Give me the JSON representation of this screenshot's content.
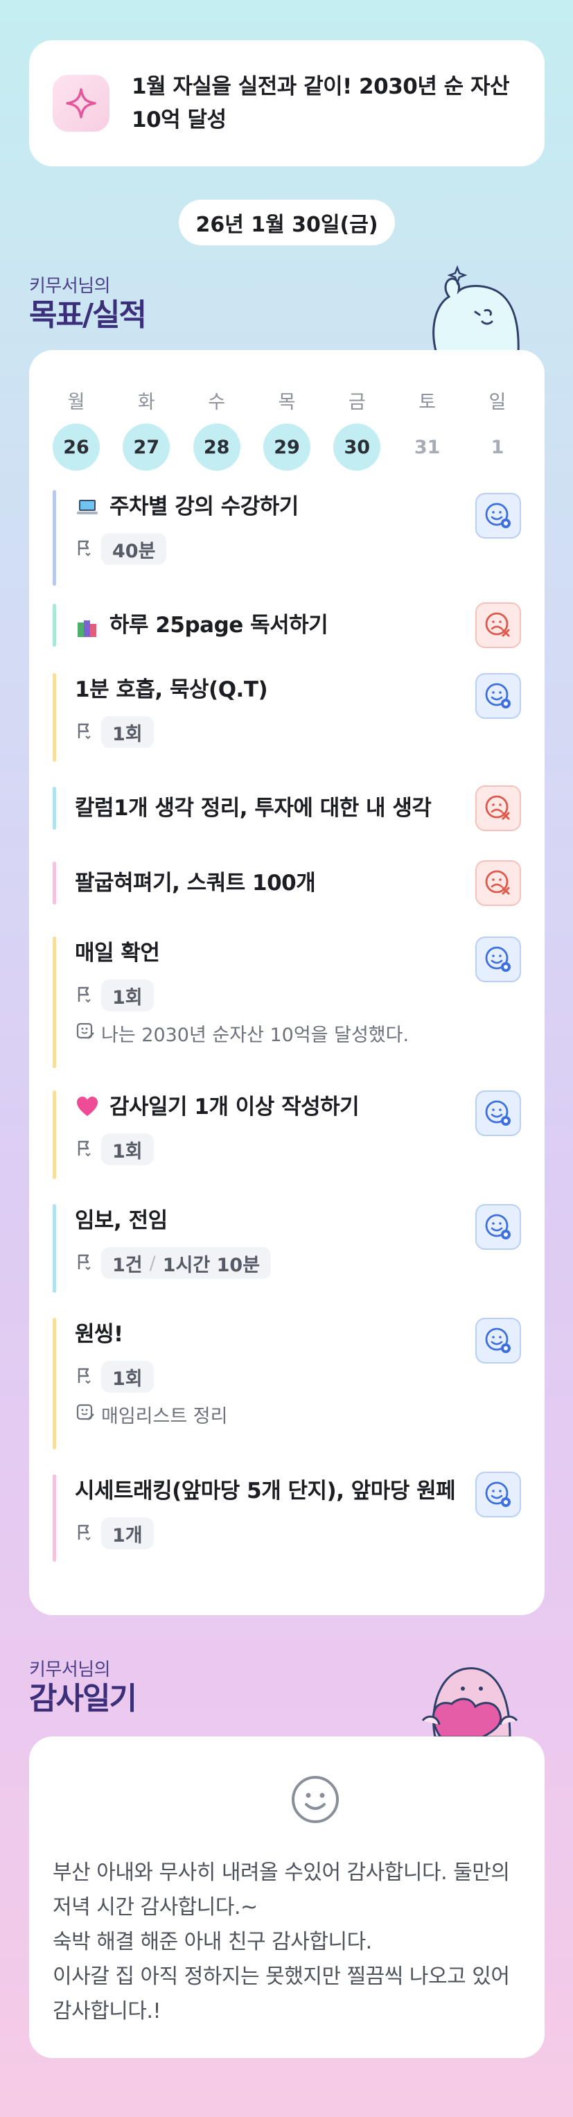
{
  "goal_banner": {
    "icon": "sparkle-icon",
    "text": "1월 자실을 실전과 같이! 2030년 순 자산 10억 달성"
  },
  "date_label": "26년 1월 30일(금)",
  "goals_section": {
    "subtitle": "키무서님의",
    "title": "목표/실적"
  },
  "week": [
    {
      "name": "월",
      "date": "26",
      "state": "done"
    },
    {
      "name": "화",
      "date": "27",
      "state": "done"
    },
    {
      "name": "수",
      "date": "28",
      "state": "done"
    },
    {
      "name": "목",
      "date": "29",
      "state": "done"
    },
    {
      "name": "금",
      "date": "30",
      "state": "done"
    },
    {
      "name": "토",
      "date": "31",
      "state": "none"
    },
    {
      "name": "일",
      "date": "1",
      "state": "none"
    }
  ],
  "items": [
    {
      "title": "주차별 강의 수강하기",
      "emoji": "laptop-icon",
      "chip": "40분",
      "status": "achieved",
      "bar_color": "#b9c8ef"
    },
    {
      "title": "하루 25page 독서하기",
      "emoji": "books-icon",
      "status": "failed",
      "bar_color": "#a8e6d8"
    },
    {
      "title": "1분 호흡, 묵상(Q.T)",
      "chip": "1회",
      "status": "achieved",
      "bar_color": "#f6de9f"
    },
    {
      "title": "칼럼1개 생각 정리, 투자에 대한 내 생각",
      "status": "failed",
      "bar_color": "#aee3ef"
    },
    {
      "title": "팔굽혀펴기, 스쿼트 100개",
      "status": "failed",
      "bar_color": "#f6c1dc"
    },
    {
      "title": "매일 확언",
      "chip": "1회",
      "note": "나는 2030년 순자산 10억을 달성했다.",
      "status": "achieved",
      "bar_color": "#f6de9f"
    },
    {
      "title": "감사일기 1개 이상 작성하기",
      "emoji": "heart-icon",
      "chip": "1회",
      "status": "achieved",
      "bar_color": "#f6de9f"
    },
    {
      "title": "임보, 전임",
      "chip": "1건",
      "chip2": "1시간 10분",
      "status": "achieved",
      "bar_color": "#aee3ef"
    },
    {
      "title": "원씽!",
      "chip": "1회",
      "note": "매임리스트 정리",
      "status": "achieved",
      "bar_color": "#f6de9f"
    },
    {
      "title": "시세트래킹(앞마당 5개 단지), 앞마당 원페",
      "chip": "1개",
      "status": "achieved",
      "bar_color": "#f6c1dc"
    }
  ],
  "diary_section": {
    "subtitle": "키무서님의",
    "title": "감사일기"
  },
  "diary": {
    "icon": "smile-icon",
    "text": "부산 아내와 무사히 내려올 수있어 감사합니다. 둘만의 저녁 시간 감사합니다.~\n숙박 해결 해준 아내 친구 감사합니다.\n이사갈 집 아직 정하지는 못했지만 찔끔씩 나오고 있어 감사합니다.!"
  }
}
